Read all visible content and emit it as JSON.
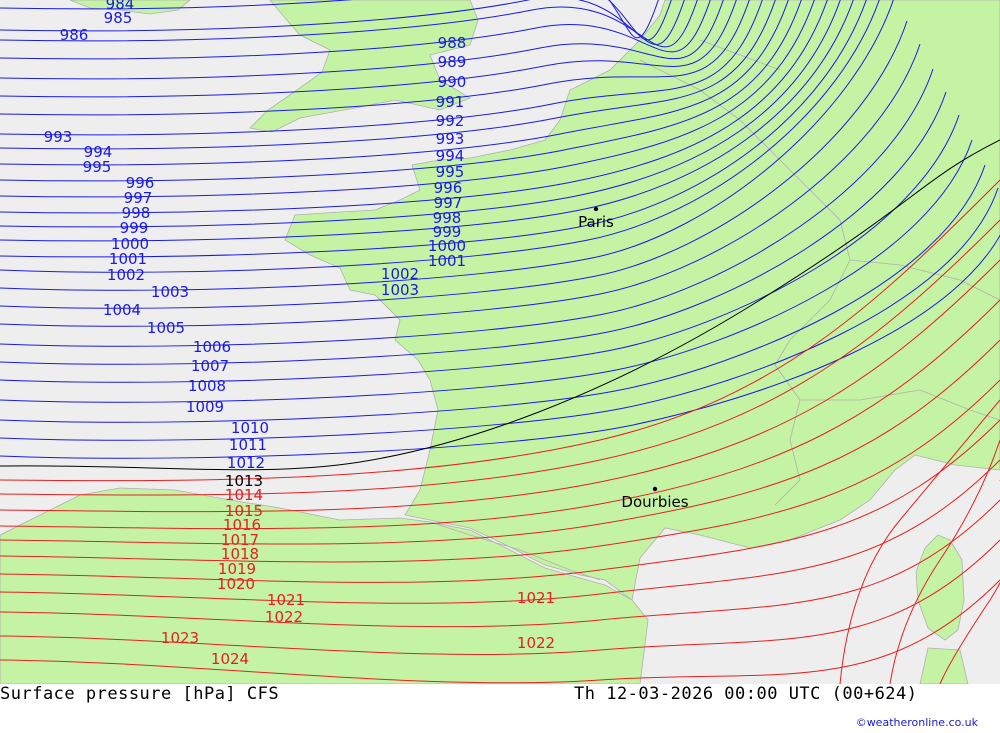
{
  "map": {
    "colors": {
      "sea": "#eeeeee",
      "land": "#c4f3a4",
      "border": "#b0b0b0",
      "low": "#1a1ae6",
      "ref": "#000000",
      "high": "#e62020"
    },
    "isobars_low": [
      {
        "value": "984"
      },
      {
        "value": "985"
      },
      {
        "value": "986"
      },
      {
        "value": "988"
      },
      {
        "value": "989"
      },
      {
        "value": "990"
      },
      {
        "value": "991"
      },
      {
        "value": "992"
      },
      {
        "value": "993"
      },
      {
        "value": "994"
      },
      {
        "value": "995"
      },
      {
        "value": "996"
      },
      {
        "value": "997"
      },
      {
        "value": "998"
      },
      {
        "value": "999"
      },
      {
        "value": "1000"
      },
      {
        "value": "1001"
      },
      {
        "value": "1002"
      },
      {
        "value": "1003"
      },
      {
        "value": "1004"
      },
      {
        "value": "1005"
      },
      {
        "value": "1006"
      },
      {
        "value": "1007"
      },
      {
        "value": "1008"
      },
      {
        "value": "1009"
      },
      {
        "value": "1010"
      },
      {
        "value": "1011"
      },
      {
        "value": "1012"
      }
    ],
    "isobar_ref": {
      "value": "1013"
    },
    "isobars_high": [
      {
        "value": "1014"
      },
      {
        "value": "1015"
      },
      {
        "value": "1016"
      },
      {
        "value": "1017"
      },
      {
        "value": "1018"
      },
      {
        "value": "1019"
      },
      {
        "value": "1020"
      },
      {
        "value": "1021"
      },
      {
        "value": "1022"
      },
      {
        "value": "1023"
      },
      {
        "value": "1024"
      }
    ],
    "cities": [
      {
        "name": "Paris"
      },
      {
        "name": "Dourbies"
      }
    ]
  },
  "footer": {
    "title": "Surface pressure [hPa] CFS",
    "datetime": "Th 12-03-2026 00:00 UTC (00+624)",
    "credit": "©weatheronline.co.uk"
  }
}
